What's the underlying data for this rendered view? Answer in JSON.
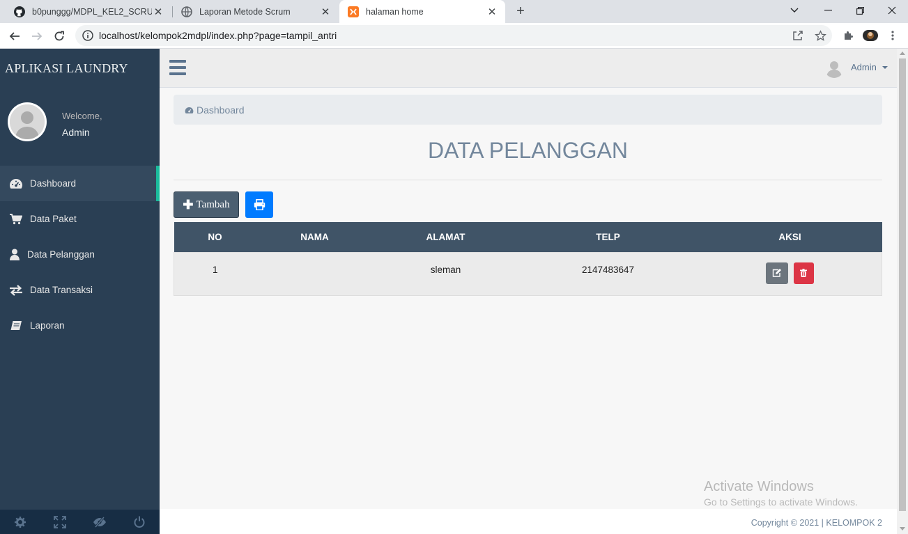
{
  "browser": {
    "tabs": [
      {
        "title": "b0punggg/MDPL_KEL2_SCRUM",
        "icon": "github-icon"
      },
      {
        "title": "Laporan Metode Scrum",
        "icon": "globe-icon"
      },
      {
        "title": "halaman home",
        "icon": "xampp-icon"
      }
    ],
    "url": "localhost/kelompok2mdpl/index.php?page=tampil_antri"
  },
  "sidebar": {
    "brand": "APLIKASI LAUNDRY",
    "welcome_label": "Welcome,",
    "user": "Admin",
    "menu": [
      {
        "label": "Dashboard",
        "icon": "dashboard-icon"
      },
      {
        "label": "Data Paket",
        "icon": "cart-icon"
      },
      {
        "label": "Data Pelanggan",
        "icon": "user-icon"
      },
      {
        "label": "Data Transaksi",
        "icon": "exchange-icon"
      },
      {
        "label": "Laporan",
        "icon": "book-icon"
      }
    ]
  },
  "topnav": {
    "user": "Admin"
  },
  "breadcrumb": {
    "label": "Dashboard"
  },
  "page": {
    "title": "DATA PELANGGAN"
  },
  "actions": {
    "add_label": "Tambah"
  },
  "table": {
    "headers": [
      "NO",
      "NAMA",
      "ALAMAT",
      "TELP",
      "AKSI"
    ],
    "rows": [
      {
        "no": "1",
        "nama": "",
        "alamat": "sleman",
        "telp": "2147483647"
      }
    ]
  },
  "watermark": {
    "line1": "Activate Windows",
    "line2": "Go to Settings to activate Windows."
  },
  "footer": {
    "copyright": "Copyright © 2021 | KELOMPOK 2"
  },
  "colors": {
    "sidebar": "#2a3f54",
    "accent": "#1abb9c",
    "table_head": "#405467",
    "print": "#007bff",
    "delete": "#dc3545"
  }
}
